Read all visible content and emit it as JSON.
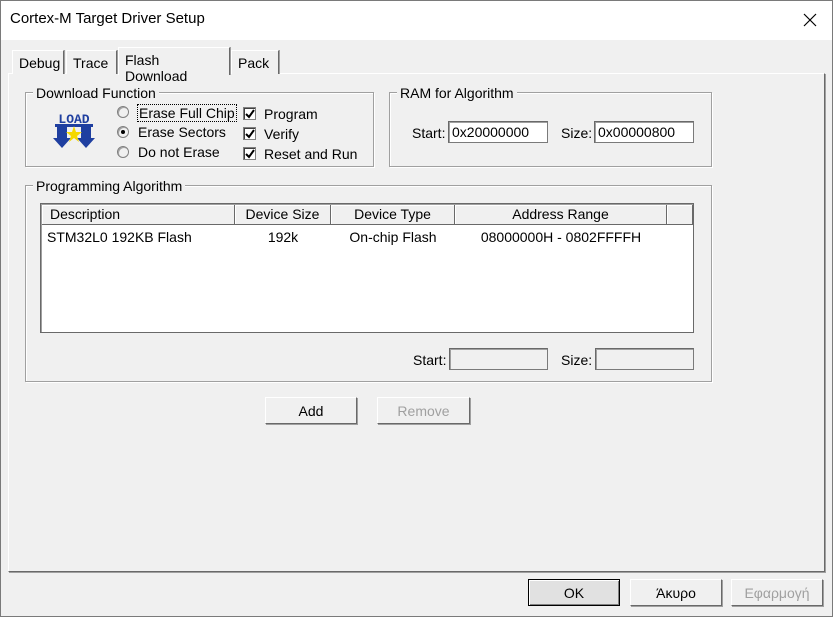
{
  "window": {
    "title": "Cortex-M Target Driver Setup"
  },
  "tabs": [
    {
      "label": "Debug",
      "active": false
    },
    {
      "label": "Trace",
      "active": false
    },
    {
      "label": "Flash Download",
      "active": true
    },
    {
      "label": "Pack",
      "active": false
    }
  ],
  "download_function": {
    "group_label": "Download Function",
    "icon_text": "LOAD",
    "radios": [
      {
        "label": "Erase Full Chip",
        "checked": false
      },
      {
        "label": "Erase Sectors",
        "checked": true
      },
      {
        "label": "Do not Erase",
        "checked": false
      }
    ],
    "checkboxes": [
      {
        "label": "Program",
        "checked": true
      },
      {
        "label": "Verify",
        "checked": true
      },
      {
        "label": "Reset and Run",
        "checked": true
      }
    ]
  },
  "ram": {
    "group_label": "RAM for Algorithm",
    "start_label": "Start:",
    "start_value": "0x20000000",
    "size_label": "Size:",
    "size_value": "0x00000800"
  },
  "programming_algorithm": {
    "group_label": "Programming Algorithm",
    "columns": [
      "Description",
      "Device Size",
      "Device Type",
      "Address Range"
    ],
    "rows": [
      {
        "description": "STM32L0 192KB Flash",
        "size": "192k",
        "type": "On-chip Flash",
        "range": "08000000H - 0802FFFFH"
      }
    ],
    "start_label": "Start:",
    "start_value": "",
    "size_label": "Size:",
    "size_value": ""
  },
  "actions": {
    "add": "Add",
    "remove": "Remove"
  },
  "footer": {
    "ok": "OK",
    "cancel": "Άκυρο",
    "apply": "Εφαρμογή"
  },
  "colors": {
    "face": "#f0f0f0",
    "icon_blue": "#1f3fa0",
    "icon_yellow": "#f5d800",
    "disabled_text": "#a0a0a0"
  }
}
